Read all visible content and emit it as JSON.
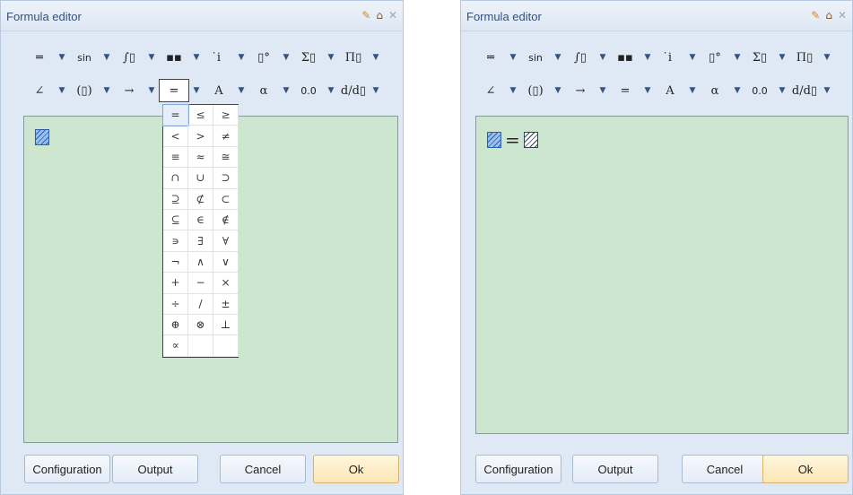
{
  "left": {
    "title": "Formula editor",
    "toolbar1": [
      {
        "name": "fraction",
        "label": "═"
      },
      {
        "name": "sin",
        "label": "sin"
      },
      {
        "name": "integral",
        "label": "∫▯"
      },
      {
        "name": "matrix",
        "label": "▪▪"
      },
      {
        "name": "dot",
        "label": "̇i"
      },
      {
        "name": "power",
        "label": "▯°"
      },
      {
        "name": "sum",
        "label": "Σ▯"
      },
      {
        "name": "product",
        "label": "Π▯"
      }
    ],
    "toolbar2": [
      {
        "name": "angle",
        "label": "∠"
      },
      {
        "name": "brackets",
        "label": "(▯)"
      },
      {
        "name": "arrow",
        "label": "→"
      },
      {
        "name": "relation",
        "label": "="
      },
      {
        "name": "font",
        "label": "A"
      },
      {
        "name": "greek",
        "label": "α"
      },
      {
        "name": "number",
        "label": "0.0"
      },
      {
        "name": "derivative",
        "label": "d/d▯"
      }
    ],
    "palette": [
      "=",
      "≤",
      "≥",
      "<",
      ">",
      "≠",
      "≡",
      "≈",
      "≅",
      "∩",
      "∪",
      "⊃",
      "⊇",
      "⊄",
      "⊂",
      "⊆",
      "∈",
      "∉",
      "∍",
      "∃",
      "∀",
      "¬",
      "∧",
      "∨",
      "+",
      "−",
      "×",
      "÷",
      "/",
      "±",
      "⊕",
      "⊗",
      "⊥",
      "∝",
      "",
      ""
    ],
    "buttons": {
      "configuration": "Configuration",
      "output": "Output",
      "cancel": "Cancel",
      "ok": "Ok"
    }
  },
  "right": {
    "title": "Formula editor",
    "toolbar1": [
      {
        "name": "fraction",
        "label": "═"
      },
      {
        "name": "sin",
        "label": "sin"
      },
      {
        "name": "integral",
        "label": "∫▯"
      },
      {
        "name": "matrix",
        "label": "▪▪"
      },
      {
        "name": "dot",
        "label": "̇i"
      },
      {
        "name": "power",
        "label": "▯°"
      },
      {
        "name": "sum",
        "label": "Σ▯"
      },
      {
        "name": "product",
        "label": "Π▯"
      }
    ],
    "toolbar2": [
      {
        "name": "angle",
        "label": "∠"
      },
      {
        "name": "brackets",
        "label": "(▯)"
      },
      {
        "name": "arrow",
        "label": "→"
      },
      {
        "name": "relation",
        "label": "="
      },
      {
        "name": "font",
        "label": "A"
      },
      {
        "name": "greek",
        "label": "α"
      },
      {
        "name": "number",
        "label": "0.0"
      },
      {
        "name": "derivative",
        "label": "d/d▯"
      }
    ],
    "formula_operator": "=",
    "buttons": {
      "configuration": "Configuration",
      "output": "Output",
      "cancel": "Cancel",
      "ok": "Ok"
    }
  },
  "caret_glyph": "▼"
}
